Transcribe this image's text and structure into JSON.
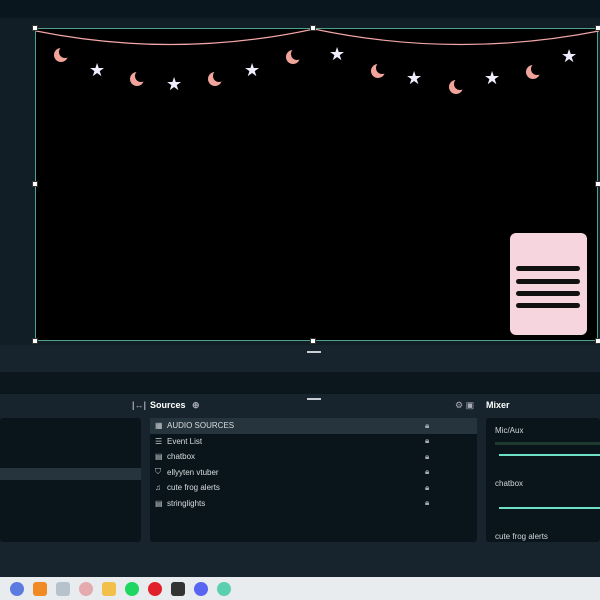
{
  "sources": {
    "title": "Sources",
    "items": [
      {
        "label": "AUDIO SOURCES",
        "icon": "folder-icon",
        "selected": true
      },
      {
        "label": "Event List",
        "icon": "list-icon"
      },
      {
        "label": "chatbox",
        "icon": "file-icon"
      },
      {
        "label": "ellyyten vtuber",
        "icon": "vtuber-icon"
      },
      {
        "label": "cute frog alerts",
        "icon": "bell-icon"
      },
      {
        "label": "stringlights",
        "icon": "file-icon"
      }
    ]
  },
  "mixer": {
    "title": "Mixer",
    "channels": [
      {
        "label": "Mic/Aux"
      },
      {
        "label": "chatbox"
      },
      {
        "label": "cute frog alerts"
      }
    ]
  },
  "colors": {
    "accent": "#6fe0c8",
    "canvas_border": "#4fa08c"
  }
}
